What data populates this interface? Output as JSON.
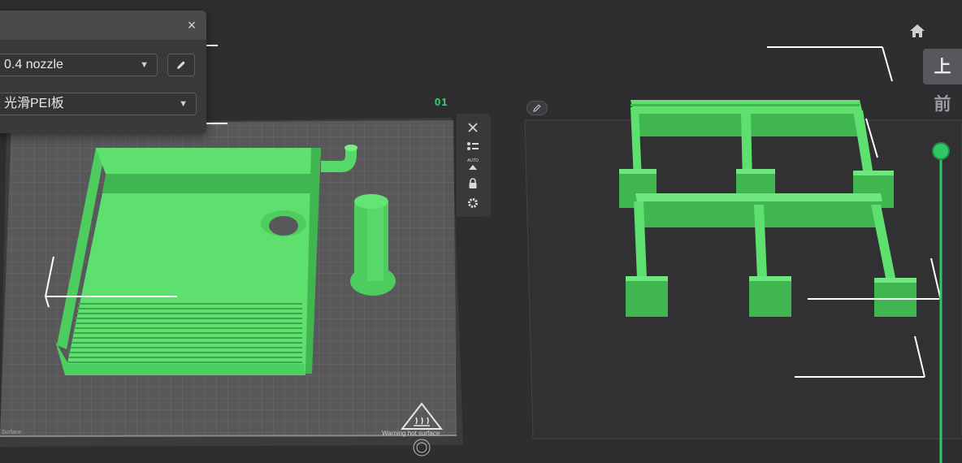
{
  "settings_panel": {
    "nozzle_value": "0.4 nozzle",
    "plate_value": "光滑PEI板",
    "close_glyph": "×"
  },
  "plate": {
    "number": "01",
    "warning_text": "Warning hot surface",
    "surface_text": "Surface"
  },
  "plate_toolbar": {
    "auto_label": "AUTO",
    "icons": [
      "close-icon",
      "list-icon",
      "auto-orient-icon",
      "lock-icon",
      "gear-icon"
    ]
  },
  "view_controls": {
    "top_view_label": "上",
    "front_view_label": "前"
  },
  "layer_slider": {
    "position": 0.0
  },
  "colors": {
    "model_green": "#5ee06f",
    "accent_green": "#2fc864",
    "plate_grey": "#58585b",
    "background": "#2e2e31"
  }
}
